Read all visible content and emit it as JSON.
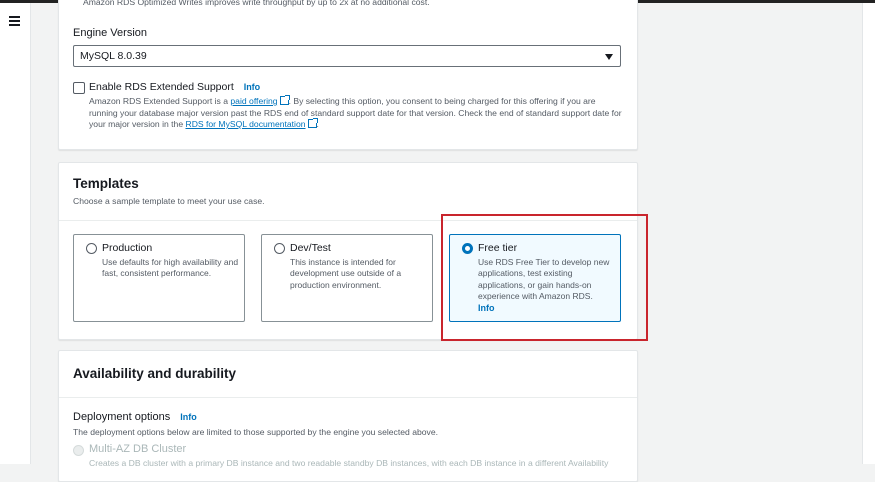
{
  "header": {
    "menu_icon": "hamburger-icon"
  },
  "engine": {
    "clipped_desc": "Amazon RDS Optimized Writes improves write throughput by up to 2x at no additional cost.",
    "version_label": "Engine Version",
    "version_value": "MySQL 8.0.39",
    "extended_support_label": "Enable RDS Extended Support",
    "info": "Info",
    "desc_part1": "Amazon RDS Extended Support is a ",
    "paid_offering": "paid offering",
    "desc_part2": ". By selecting this option, you consent to being charged for this offering if you are running your database major version past the RDS end of standard support date for that version. Check the end of standard support date for your major version in the ",
    "doc_link": "RDS for MySQL documentation",
    "desc_part3": "."
  },
  "templates": {
    "title": "Templates",
    "subtitle": "Choose a sample template to meet your use case.",
    "options": [
      {
        "title": "Production",
        "desc": "Use defaults for high availability and fast, consistent performance."
      },
      {
        "title": "Dev/Test",
        "desc": "This instance is intended for development use outside of a production environment."
      },
      {
        "title": "Free tier",
        "desc": "Use RDS Free Tier to develop new applications, test existing applications, or gain hands-on experience with Amazon RDS.",
        "info": "Info"
      }
    ],
    "selected": "Free tier"
  },
  "availability": {
    "title": "Availability and durability",
    "deployment_label": "Deployment options",
    "info": "Info",
    "deployment_desc": "The deployment options below are limited to those supported by the engine you selected above.",
    "multiaz_label": "Multi-AZ DB Cluster",
    "multiaz_desc": "Creates a DB cluster with a primary DB instance and two readable standby DB instances, with each DB instance in a different Availability"
  },
  "colors": {
    "accent": "#0073bb",
    "highlight": "#c9252d"
  }
}
